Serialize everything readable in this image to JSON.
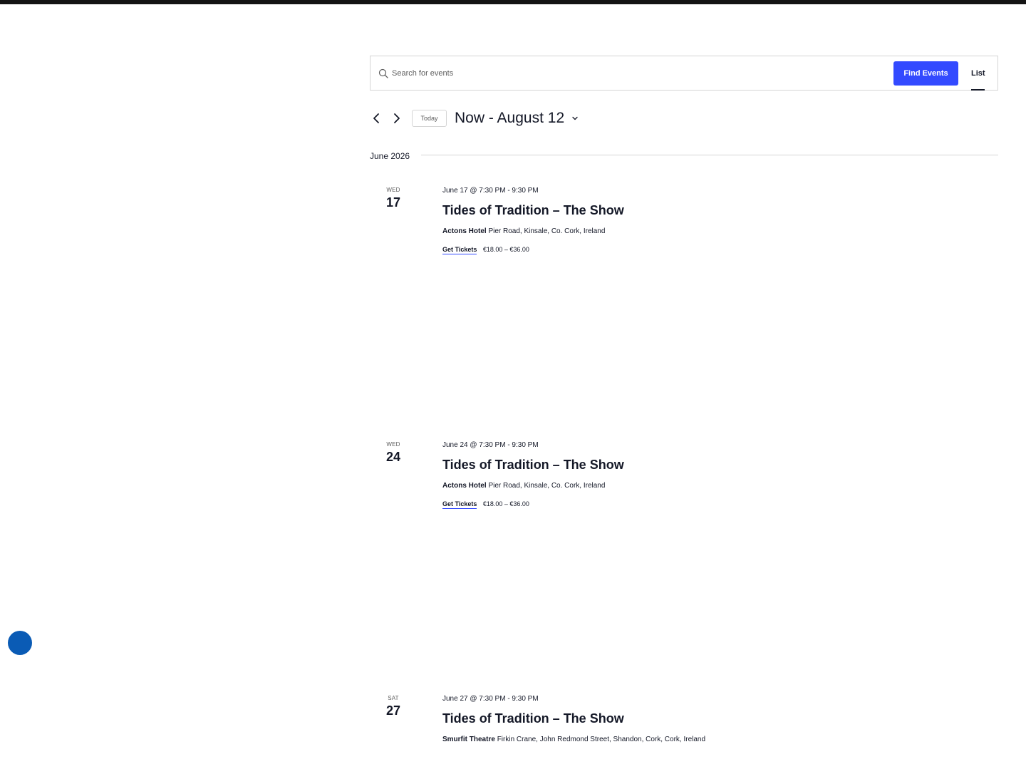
{
  "search": {
    "placeholder": "Search for events",
    "value": "",
    "find_label": "Find Events",
    "view_label": "List"
  },
  "nav": {
    "today_label": "Today",
    "range_start": "Now",
    "range_separator": "-",
    "range_end": "August 12"
  },
  "month": {
    "label": "June 2026"
  },
  "events": [
    {
      "dow": "Wed",
      "day": "17",
      "time": "June 17 @ 7:30 PM - 9:30 PM",
      "title": "Tides of Tradition – The Show",
      "venue_name": "Actons Hotel",
      "venue_address": "Pier Road, Kinsale, Co. Cork, Ireland",
      "tickets_label": "Get Tickets",
      "price": "€18.00 – €36.00"
    },
    {
      "dow": "Wed",
      "day": "24",
      "time": "June 24 @ 7:30 PM - 9:30 PM",
      "title": "Tides of Tradition – The Show",
      "venue_name": "Actons Hotel",
      "venue_address": "Pier Road, Kinsale, Co. Cork, Ireland",
      "tickets_label": "Get Tickets",
      "price": "€18.00 – €36.00"
    },
    {
      "dow": "Sat",
      "day": "27",
      "time": "June 27 @ 7:30 PM - 9:30 PM",
      "title": "Tides of Tradition – The Show",
      "venue_name": "Smurfit Theatre",
      "venue_address": "Firkin Crane, John Redmond Street, Shandon, Cork, Cork, Ireland"
    }
  ],
  "icons": {
    "search": "search-icon",
    "prev": "chevron-left-icon",
    "next": "chevron-right-icon",
    "range_dropdown": "chevron-down-icon"
  },
  "colors": {
    "accent": "#334aff",
    "text": "#141827",
    "muted": "#5d5d5d",
    "border": "#d5d5d5",
    "floating_button": "#0a5bb5",
    "top_bar": "#141414"
  }
}
